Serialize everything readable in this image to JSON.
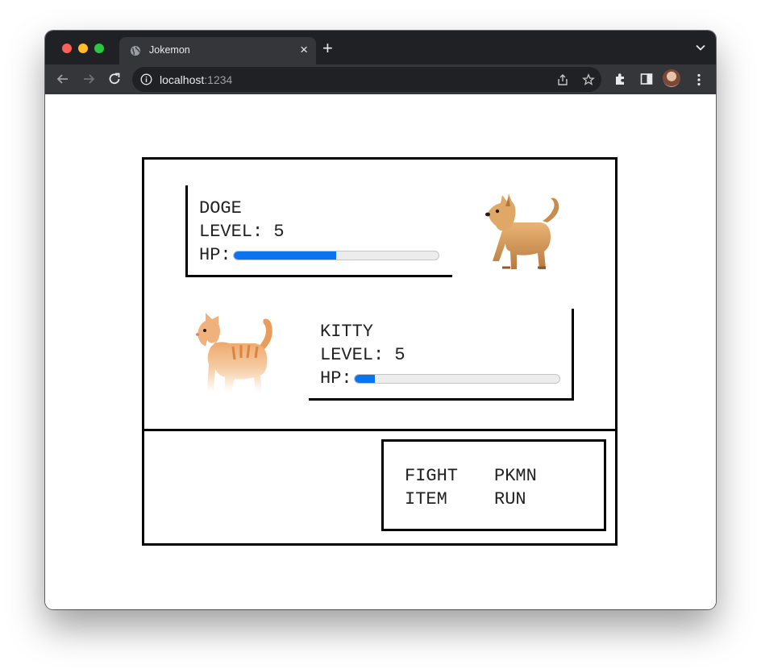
{
  "browser": {
    "tab_title": "Jokemon",
    "url_host": "localhost",
    "url_port": ":1234"
  },
  "battle": {
    "enemy": {
      "name": "DOGE",
      "level_text": "LEVEL: 5",
      "hp_label": "HP:",
      "hp_fraction": 0.5,
      "sprite": "dog-icon"
    },
    "player": {
      "name": "KITTY",
      "level_text": "LEVEL: 5",
      "hp_label": "HP:",
      "hp_fraction": 0.1,
      "sprite": "cat-icon"
    }
  },
  "menu": {
    "fight": "FIGHT",
    "pkmn": "PKMN",
    "item": "ITEM",
    "run": "RUN"
  },
  "colors": {
    "hp_fill": "#0a74f0",
    "chrome_dark": "#202124",
    "chrome_tab": "#35363a"
  }
}
